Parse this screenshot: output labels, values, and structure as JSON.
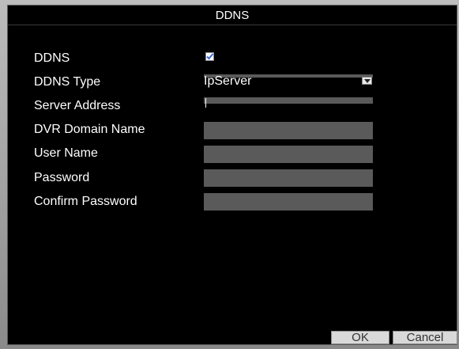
{
  "dialog": {
    "title": "DDNS"
  },
  "form": {
    "ddns_label": "DDNS",
    "ddns_enabled": true,
    "ddns_type_label": "DDNS Type",
    "ddns_type_value": "IpServer",
    "server_address_label": "Server Address",
    "server_address_value": "",
    "dvr_domain_label": "DVR Domain Name",
    "dvr_domain_value": "",
    "user_name_label": "User Name",
    "user_name_value": "",
    "password_label": "Password",
    "password_value": "",
    "confirm_password_label": "Confirm Password",
    "confirm_password_value": ""
  },
  "buttons": {
    "ok_label": "OK",
    "cancel_label": "Cancel"
  },
  "colors": {
    "background": "#000000",
    "field": "#5a5a5a",
    "check": "#3b6bd6"
  }
}
